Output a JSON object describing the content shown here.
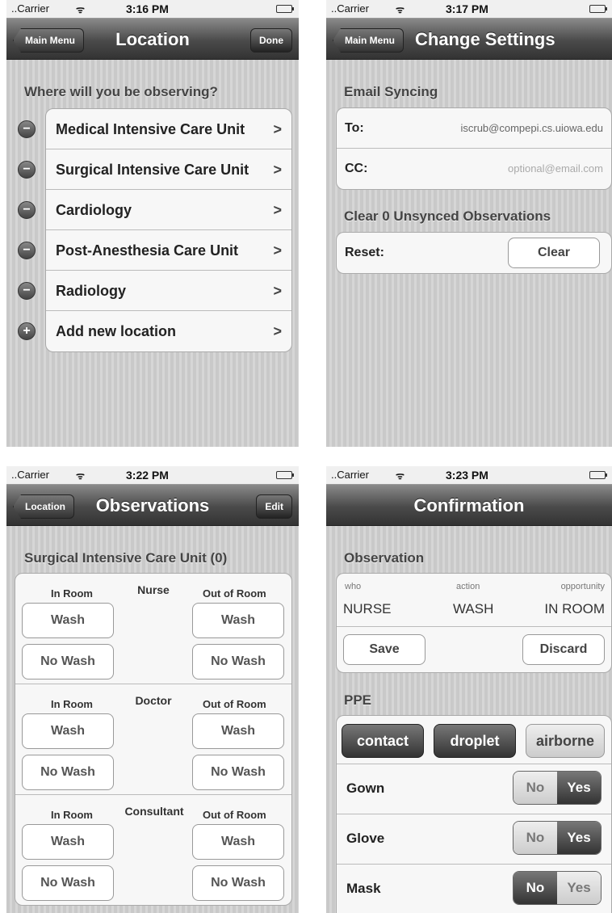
{
  "screens": [
    {
      "status": {
        "carrier": "Carrier",
        "time": "3:16 PM"
      },
      "nav": {
        "back": "Main Menu",
        "title": "Location",
        "right": "Done"
      },
      "header": "Where will you be observing?",
      "rows": [
        {
          "label": "Medical Intensive Care Unit",
          "icon": "minus-icon"
        },
        {
          "label": "Surgical Intensive Care Unit",
          "icon": "minus-icon"
        },
        {
          "label": "Cardiology",
          "icon": "minus-icon"
        },
        {
          "label": "Post-Anesthesia Care Unit",
          "icon": "minus-icon"
        },
        {
          "label": "Radiology",
          "icon": "minus-icon"
        },
        {
          "label": "Add new location",
          "icon": "plus-icon"
        }
      ],
      "chevron": ">"
    },
    {
      "status": {
        "carrier": "Carrier",
        "time": "3:17 PM"
      },
      "nav": {
        "back": "Main Menu",
        "title": "Change Settings"
      },
      "email_header": "Email Syncing",
      "to_label": "To:",
      "to_value": "iscrub@compepi.cs.uiowa.edu",
      "cc_label": "CC:",
      "cc_placeholder": "optional@email.com",
      "clear_header": "Clear 0 Unsynced Observations",
      "reset_label": "Reset:",
      "clear_button": "Clear"
    },
    {
      "status": {
        "carrier": "Carrier",
        "time": "3:22 PM"
      },
      "nav": {
        "back": "Location",
        "title": "Observations",
        "right": "Edit"
      },
      "header": "Surgical Intensive Care Unit (0)",
      "in_room": "In Room",
      "out_room": "Out of Room",
      "wash": "Wash",
      "no_wash": "No Wash",
      "groups": [
        "Nurse",
        "Doctor",
        "Consultant"
      ]
    },
    {
      "status": {
        "carrier": "Carrier",
        "time": "3:23 PM"
      },
      "nav": {
        "title": "Confirmation"
      },
      "obs_header": "Observation",
      "who_label": "who",
      "action_label": "action",
      "opp_label": "opportunity",
      "who": "NURSE",
      "action": "WASH",
      "opp": "IN ROOM",
      "save": "Save",
      "discard": "Discard",
      "ppe_header": "PPE",
      "ppe": [
        {
          "label": "contact",
          "selected": true
        },
        {
          "label": "droplet",
          "selected": true
        },
        {
          "label": "airborne",
          "selected": false
        }
      ],
      "no": "No",
      "yes": "Yes",
      "toggles": [
        {
          "label": "Gown",
          "value": "Yes"
        },
        {
          "label": "Glove",
          "value": "Yes"
        },
        {
          "label": "Mask",
          "value": "No"
        }
      ]
    }
  ]
}
